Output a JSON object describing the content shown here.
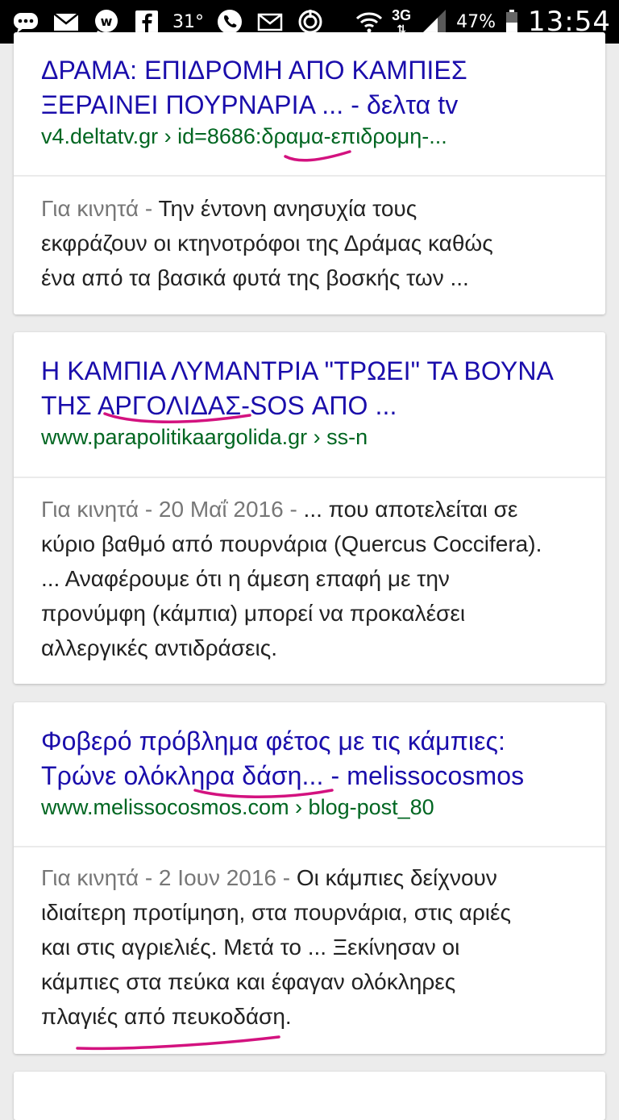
{
  "status_bar": {
    "icons": [
      "chat-icon",
      "mail-icon",
      "whatsapp-icon",
      "facebook-icon",
      "temperature",
      "phone-icon",
      "envelope-icon",
      "sync-icon",
      "wifi-icon",
      "signal-icon",
      "battery-icon"
    ],
    "temperature": "31°",
    "network": "3G",
    "battery": "47%",
    "time": "13:54"
  },
  "results": [
    {
      "title_line1": "ΔΡΑΜΑ: ΕΠΙΔΡΟΜΗ ΑΠΟ ΚΑΜΠΙΕΣ",
      "title_line2": "ΞΕΡΑΙΝΕΙ ΠΟΥΡΝΑΡΙΑ ... - δελτα tv",
      "url": "v4.deltatv.gr › id=8686:δραμα-επιδρομη-...",
      "meta": "Για κινητά - ",
      "snippet_line1": "Την έντονη ανησυχία τους",
      "snippet_line2": "εκφράζουν οι κτηνοτρόφοι της Δράμας καθώς",
      "snippet_line3": "ένα από τα βασικά φυτά της βοσκής των ..."
    },
    {
      "title_line1": "Η ΚΑΜΠΙΑ ΛΥΜΑΝΤΡΙΑ \"ΤΡΩΕΙ\" ΤΑ ΒΟΥΝΑ",
      "title_line2": "ΤΗΣ ΑΡΓΟΛΙΔΑΣ-SOS ΑΠΟ ...",
      "url": "www.parapolitikaargolida.gr › ss-n",
      "meta": "Για κινητά - 20 Μαΐ 2016 - ",
      "snippet_line1": "... που αποτελείται σε",
      "snippet_line2": "κύριο βαθμό από πουρνάρια (Quercus Coccifera).",
      "snippet_line3": "... Αναφέρουμε ότι η άμεση επαφή με την",
      "snippet_line4": "προνύμφη (κάμπια) μπορεί να προκαλέσει",
      "snippet_line5": "αλλεργικές αντιδράσεις."
    },
    {
      "title_line1": "Φοβερό πρόβλημα φέτος με τις κάμπιες:",
      "title_line2": "Τρώνε ολόκληρα δάση... - melissocosmos",
      "url": "www.melissocosmos.com › blog-post_80",
      "meta": "Για κινητά - 2 Ιουν 2016 - ",
      "snippet_line1": "Οι κάμπιες δείχνουν",
      "snippet_line2": "ιδιαίτερη προτίμηση, στα πουρνάρια, στις αριές",
      "snippet_line3": "και στις αγριελιές. Μετά το ... Ξεκίνησαν οι",
      "snippet_line4": "κάμπιες στα πεύκα και έφαγαν ολόκληρες",
      "snippet_line5": "πλαγιές από πευκοδάση."
    }
  ],
  "colors": {
    "title": "#1a0dab",
    "url": "#006621",
    "meta": "#777777",
    "annotation": "#d3127f"
  }
}
